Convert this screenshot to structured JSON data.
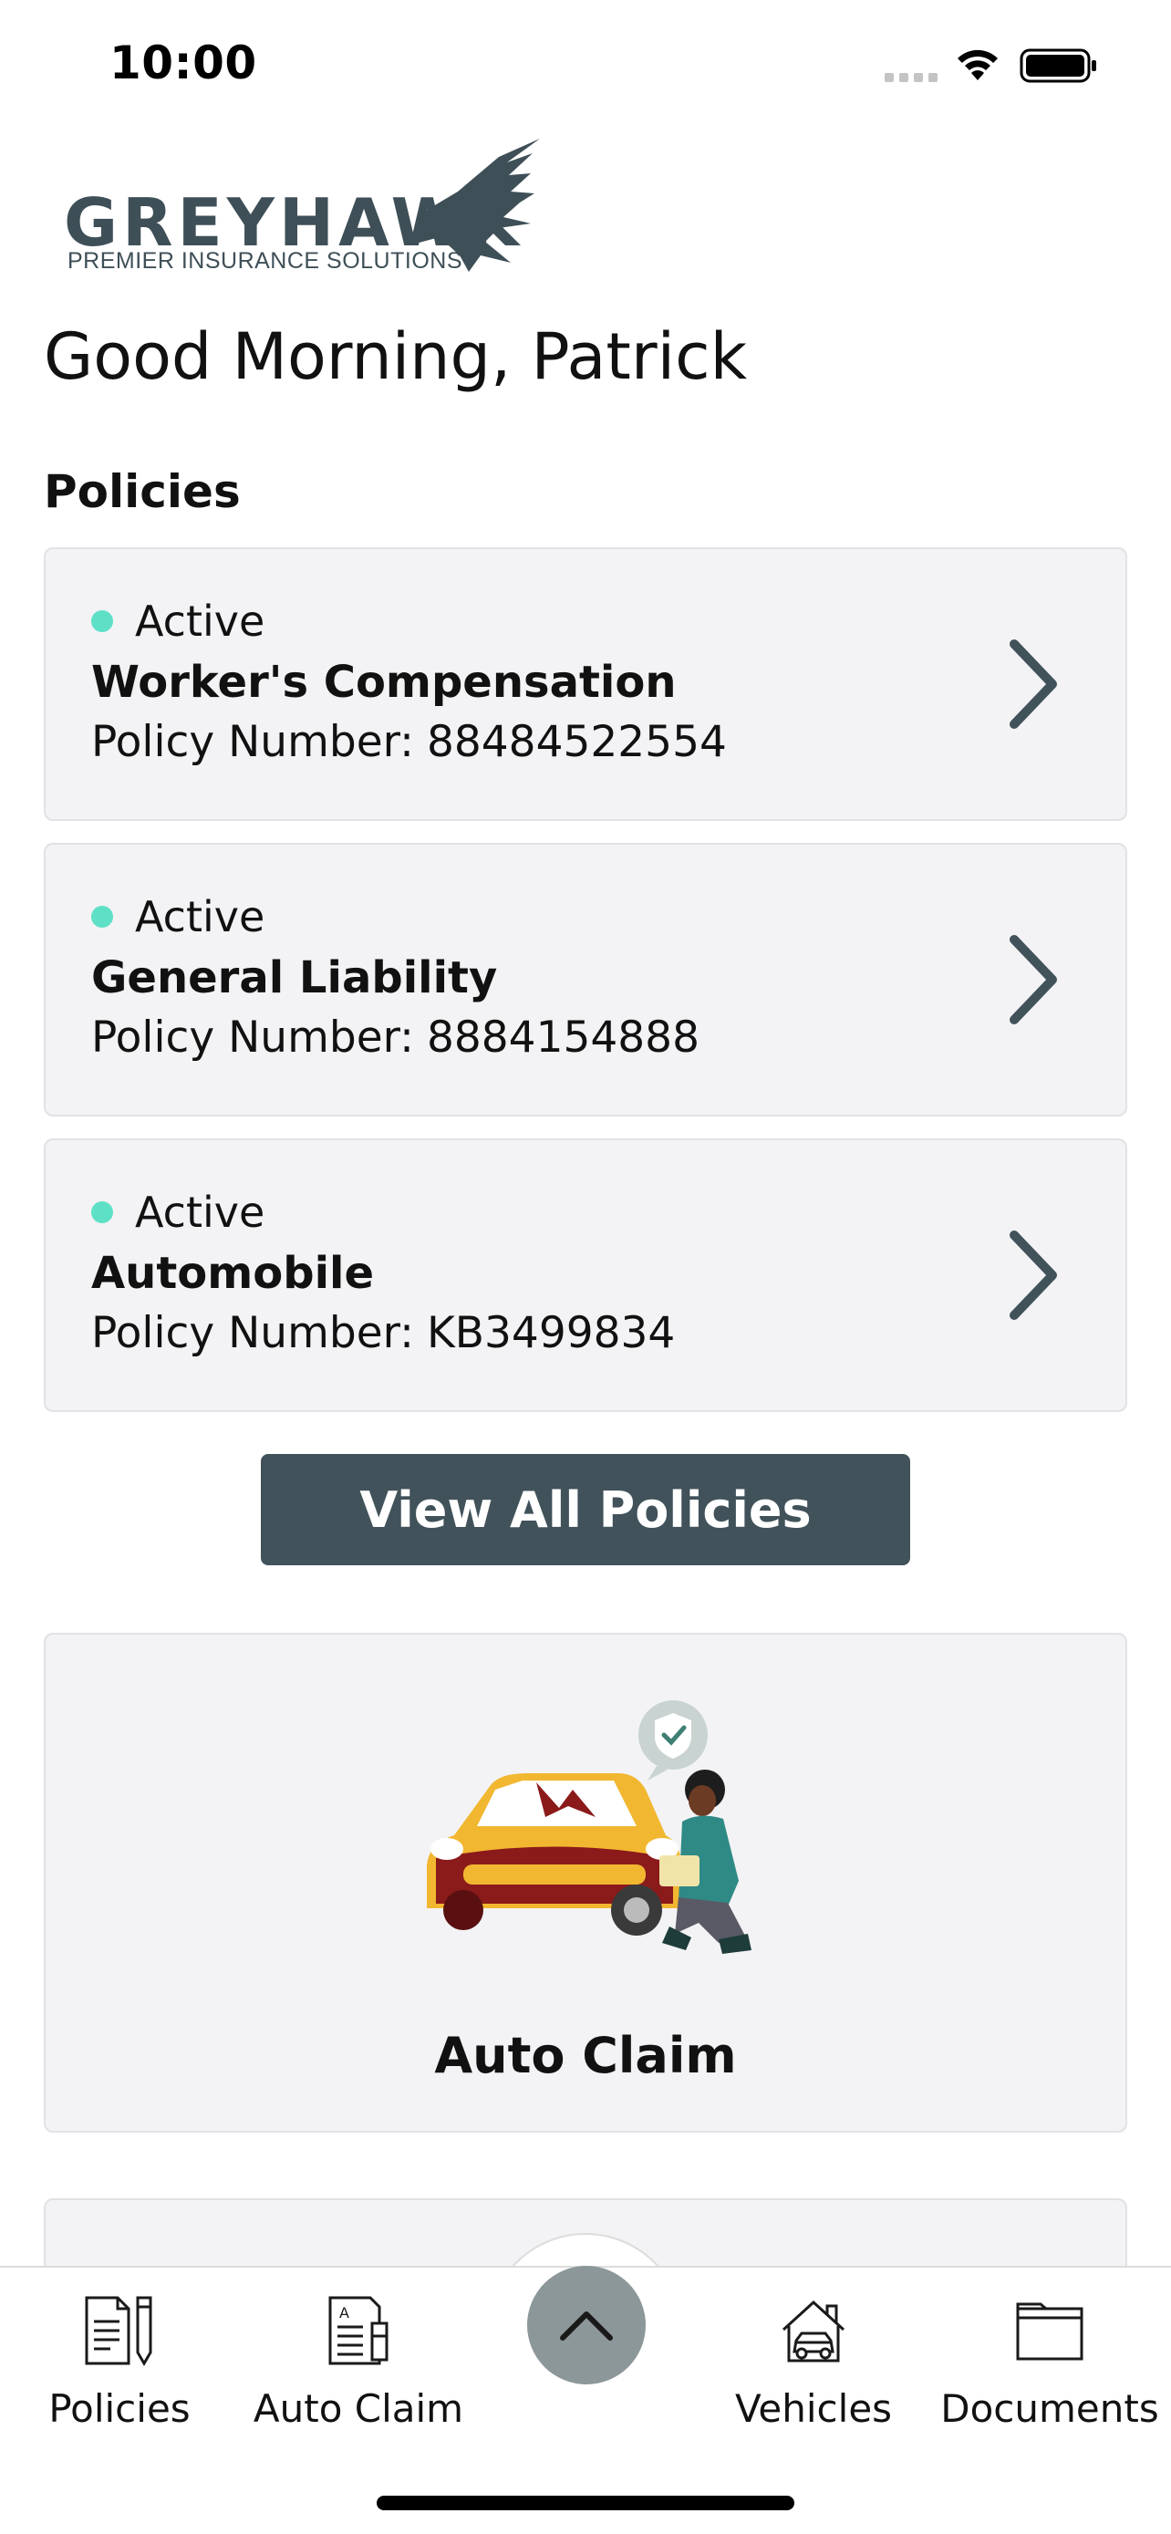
{
  "status_bar": {
    "time": "10:00"
  },
  "brand": {
    "name": "GREYHAWK",
    "tagline": "PREMIER INSURANCE SOLUTIONS"
  },
  "greeting": "Good Morning, Patrick",
  "policies_section": {
    "title": "Policies",
    "items": [
      {
        "status": "Active",
        "name": "Worker's Compensation",
        "number_label": "Policy Number:",
        "number": "88484522554"
      },
      {
        "status": "Active",
        "name": "General Liability",
        "number_label": "Policy Number:",
        "number": "8884154888"
      },
      {
        "status": "Active",
        "name": "Automobile",
        "number_label": "Policy Number:",
        "number": "KB3499834"
      }
    ],
    "view_all_label": "View All Policies"
  },
  "quick_actions": [
    {
      "label": "Auto Claim"
    }
  ],
  "tab_bar": {
    "items": [
      {
        "label": "Policies",
        "icon": "policies-icon"
      },
      {
        "label": "Auto Claim",
        "icon": "auto-claim-icon"
      },
      {
        "label": "Vehicles",
        "icon": "vehicles-icon"
      },
      {
        "label": "Documents",
        "icon": "documents-icon"
      }
    ],
    "center_icon": "chevron-up-icon"
  },
  "colors": {
    "brand": "#3f4f57",
    "button": "#41525a",
    "active_dot": "#5ee0c6",
    "card_bg": "#f3f3f5",
    "fab": "#8c9799"
  }
}
